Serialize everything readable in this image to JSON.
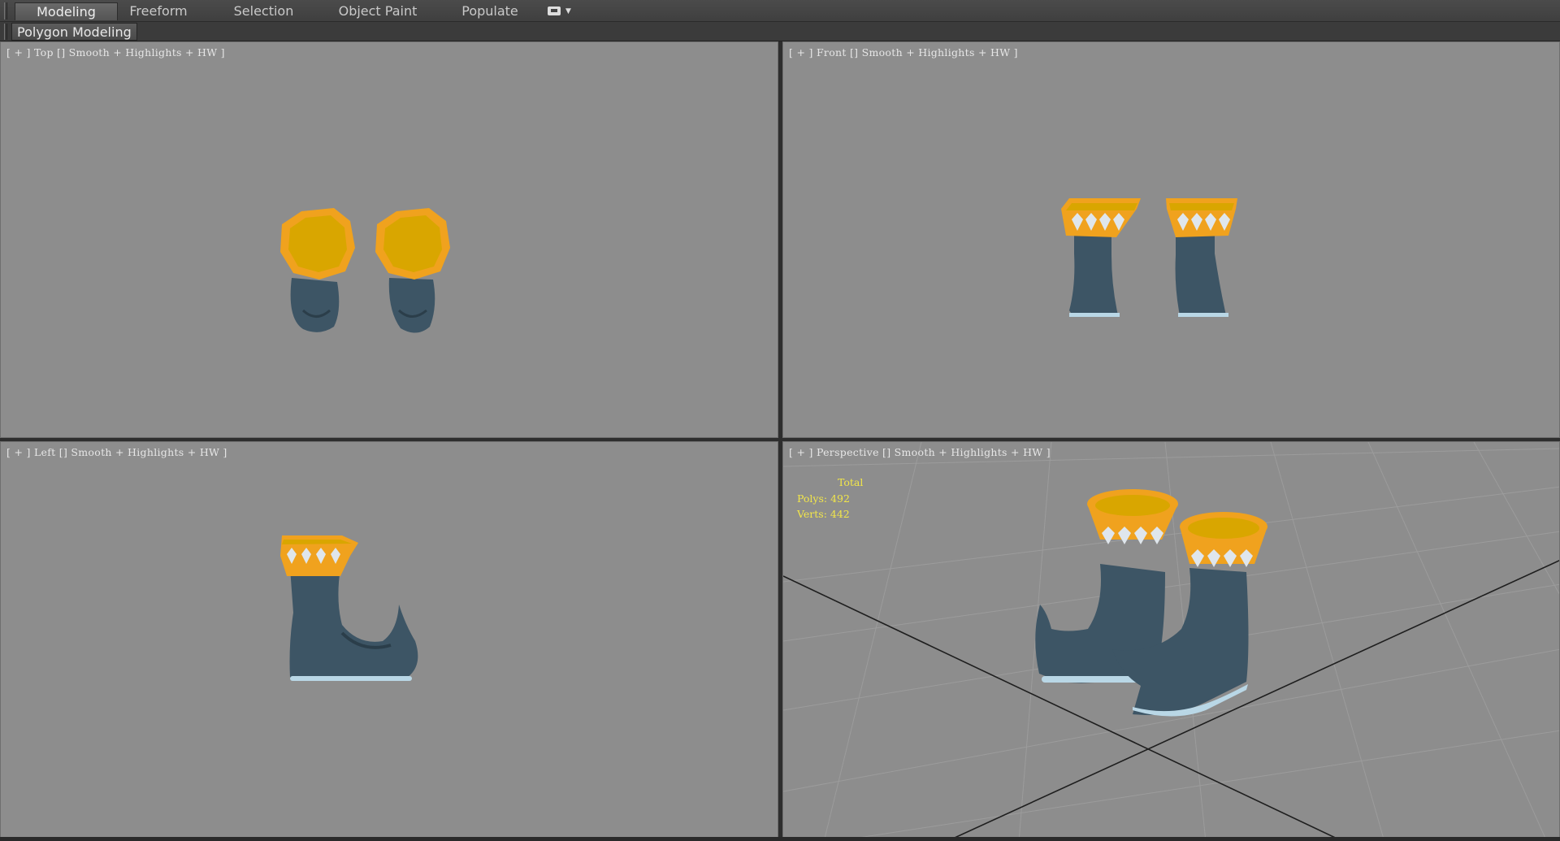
{
  "ribbon": {
    "tabs": [
      {
        "label": "Modeling",
        "active": true
      },
      {
        "label": "Freeform",
        "active": false
      },
      {
        "label": "Selection",
        "active": false
      },
      {
        "label": "Object Paint",
        "active": false
      },
      {
        "label": "Populate",
        "active": false
      }
    ],
    "panel_label": "Polygon Modeling"
  },
  "viewports": {
    "top": {
      "label": "[ + ] Top [] Smooth + Highlights + HW ]"
    },
    "front": {
      "label": "[ + ] Front [] Smooth + Highlights + HW ]"
    },
    "left": {
      "label": "[ + ] Left [] Smooth + Highlights + HW ]"
    },
    "perspective": {
      "label": "[ + ] Perspective [] Smooth + Highlights + HW ]"
    }
  },
  "stats": {
    "total_label": "Total",
    "polys": "Polys: 492",
    "verts": "Verts: 442"
  },
  "colors": {
    "viewport_bg": "#8d8d8d",
    "boot_body": "#3d5565",
    "boot_cuff": "#f0a21e",
    "boot_cuff_inner": "#d9a600",
    "stats_text": "#f2e64a"
  }
}
